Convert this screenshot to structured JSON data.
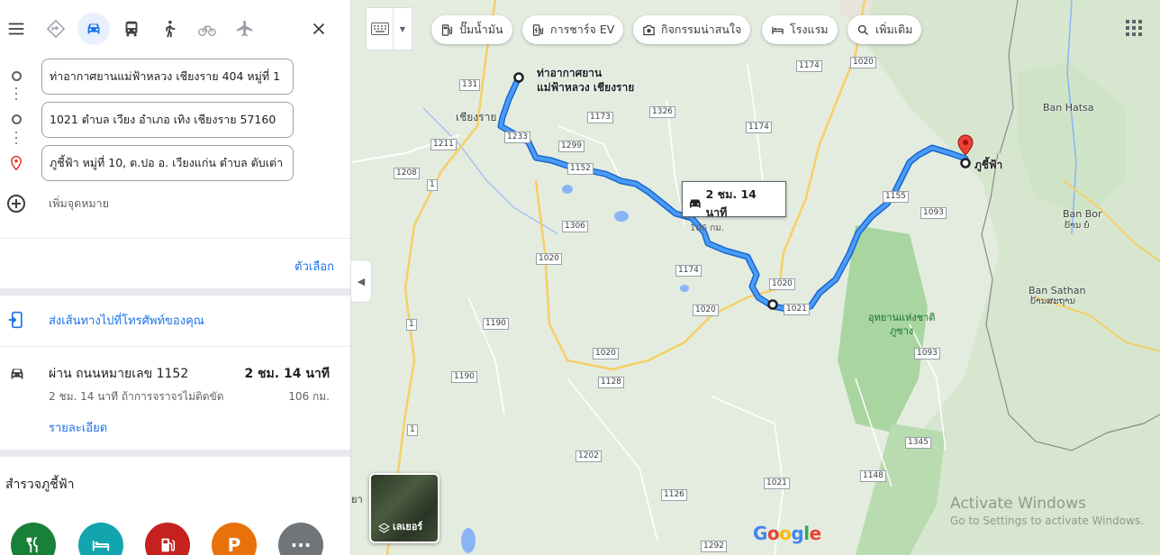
{
  "modes": [
    {
      "name": "best-route",
      "icon": "directions-diamond-icon"
    },
    {
      "name": "driving",
      "icon": "car-icon",
      "active": true
    },
    {
      "name": "transit",
      "icon": "bus-icon"
    },
    {
      "name": "walking",
      "icon": "walk-icon"
    },
    {
      "name": "cycling",
      "icon": "bike-icon"
    },
    {
      "name": "flights",
      "icon": "plane-icon"
    }
  ],
  "waypoints": [
    {
      "value": "ท่าอากาศยานแม่ฟ้าหลวง เชียงราย 404 หมู่ที่ 1"
    },
    {
      "value": "1021 ตำบล เวียง อำเภอ เทิง เชียงราย 57160"
    },
    {
      "value": "ภูชี้ฟ้า หมู่ที่ 10, ต.ปอ อ. เวียงแก่น ตำบล ตับเต่า"
    }
  ],
  "add_destination": "เพิ่มจุดหมาย",
  "options_label": "ตัวเลือก",
  "send_to_phone": "ส่งเส้นทางไปที่โทรศัพท์ของคุณ",
  "route": {
    "via": "ผ่าน ถนนหมายเลข 1152",
    "duration": "2 ชม. 14 นาที",
    "subtitle": "2 ชม. 14 นาที ถ้าการจราจรไม่ติดขัด",
    "distance": "106 กม.",
    "details_link": "รายละเอียด"
  },
  "explore_title": "สำรวจภูชี้ฟ้า",
  "categories": [
    {
      "icon": "restaurant-icon",
      "color": "#188038"
    },
    {
      "icon": "hotel-icon",
      "color": "#12a4af"
    },
    {
      "icon": "gas-station-icon",
      "color": "#c5221f"
    },
    {
      "icon": "parking-icon",
      "color": "#e8710a",
      "glyph": "P"
    },
    {
      "icon": "more-icon",
      "color": "#70757a",
      "glyph": "···"
    }
  ],
  "chips": [
    {
      "label": "ปั๊มน้ำมัน",
      "icon": "gas-icon"
    },
    {
      "label": "การชาร์จ EV",
      "icon": "ev-charging-icon"
    },
    {
      "label": "กิจกรรมน่าสนใจ",
      "icon": "camera-icon"
    },
    {
      "label": "โรงแรม",
      "icon": "hotel-icon"
    },
    {
      "label": "เพิ่มเติม",
      "icon": "search-icon"
    }
  ],
  "tooltip": {
    "duration": "2 ชม. 14 นาที",
    "distance": "106 กม."
  },
  "map_labels": {
    "origin_line1": "ท่าอากาศยาน",
    "origin_line2": "แม่ฟ้าหลวง เชียงราย",
    "destination": "ภูชี้ฟ้า",
    "chiangrai": "เชียงราย",
    "ban_hatsa": "Ban Hatsa",
    "ban_bor": "Ban Bor",
    "ban_bor_th": "ບ້ານ ບໍ່",
    "ban_sathan": "Ban Sathan",
    "ban_sathan_th": "ບ້ານສະຖານ",
    "park_line1": "อุทยานแห่งชาติ",
    "park_line2": "ภูซาง",
    "left_edge_text": "ยา"
  },
  "road_shields": [
    "131",
    "1233",
    "1211",
    "1208",
    "1173",
    "1326",
    "1174",
    "1020",
    "1299",
    "1152",
    "1306",
    "1174",
    "1020",
    "1155",
    "1093",
    "1174",
    "1020",
    "1020",
    "1021",
    "1190",
    "1020",
    "1128",
    "1190",
    "1093",
    "1202",
    "1148",
    "1345",
    "1126",
    "1021",
    "1292",
    "1"
  ],
  "layers_label": "เลเยอร์",
  "google_text": "Google",
  "activate_windows": {
    "line1": "Activate Windows",
    "line2": "Go to Settings to activate Windows."
  }
}
